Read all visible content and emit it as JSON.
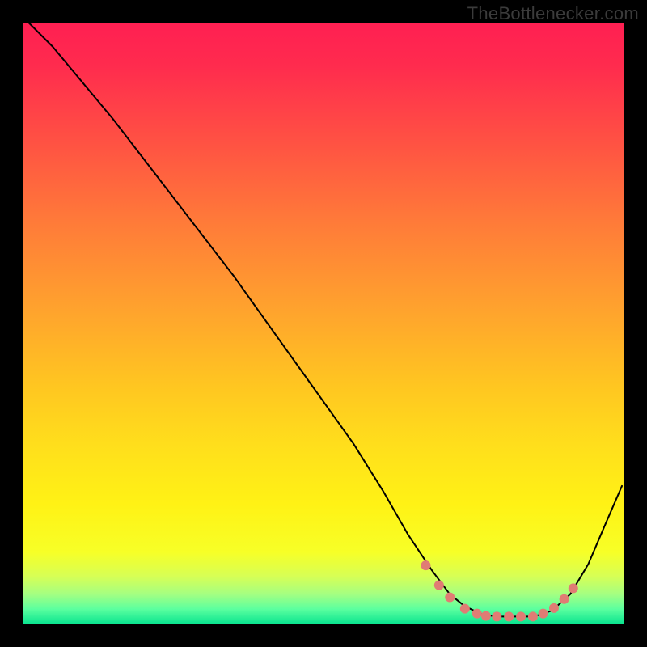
{
  "watermark": "TheBottlenecker.com",
  "chart_data": {
    "type": "line",
    "title": "",
    "xlabel": "",
    "ylabel": "",
    "xlim": [
      0,
      100
    ],
    "ylim": [
      0,
      100
    ],
    "background_gradient_stops": [
      {
        "offset": 0.0,
        "color": "#ff1f52"
      },
      {
        "offset": 0.07,
        "color": "#ff2b4e"
      },
      {
        "offset": 0.2,
        "color": "#ff5243"
      },
      {
        "offset": 0.33,
        "color": "#ff7a39"
      },
      {
        "offset": 0.47,
        "color": "#ffa12e"
      },
      {
        "offset": 0.6,
        "color": "#ffc521"
      },
      {
        "offset": 0.7,
        "color": "#ffde1c"
      },
      {
        "offset": 0.8,
        "color": "#fff215"
      },
      {
        "offset": 0.88,
        "color": "#f7ff27"
      },
      {
        "offset": 0.92,
        "color": "#d7ff55"
      },
      {
        "offset": 0.95,
        "color": "#a4ff82"
      },
      {
        "offset": 0.975,
        "color": "#5aff9f"
      },
      {
        "offset": 1.0,
        "color": "#07e38f"
      }
    ],
    "series": [
      {
        "name": "bottleneck-curve",
        "color": "#000000",
        "stroke_width": 2.0,
        "x": [
          1,
          5,
          10,
          15,
          20,
          25,
          30,
          35,
          40,
          45,
          50,
          55,
          60,
          64,
          68,
          71,
          73.5,
          76.5,
          79,
          82,
          85,
          88,
          91,
          94,
          97,
          99.6
        ],
        "y": [
          100,
          96,
          90,
          84,
          77.5,
          71,
          64.5,
          58,
          51,
          44,
          37,
          30,
          22,
          15,
          9,
          5,
          3,
          1.6,
          1.3,
          1.3,
          1.3,
          2.3,
          5,
          10,
          17,
          23
        ]
      }
    ],
    "markers": {
      "name": "valley-dots",
      "color": "#e07c74",
      "radius": 6,
      "points": [
        {
          "x": 67.0,
          "y": 9.8
        },
        {
          "x": 69.2,
          "y": 6.5
        },
        {
          "x": 71.0,
          "y": 4.5
        },
        {
          "x": 73.5,
          "y": 2.6
        },
        {
          "x": 75.5,
          "y": 1.8
        },
        {
          "x": 77.0,
          "y": 1.4
        },
        {
          "x": 78.8,
          "y": 1.3
        },
        {
          "x": 80.8,
          "y": 1.3
        },
        {
          "x": 82.8,
          "y": 1.3
        },
        {
          "x": 84.8,
          "y": 1.3
        },
        {
          "x": 86.5,
          "y": 1.8
        },
        {
          "x": 88.3,
          "y": 2.7
        },
        {
          "x": 90.0,
          "y": 4.2
        },
        {
          "x": 91.5,
          "y": 6.0
        }
      ]
    }
  }
}
